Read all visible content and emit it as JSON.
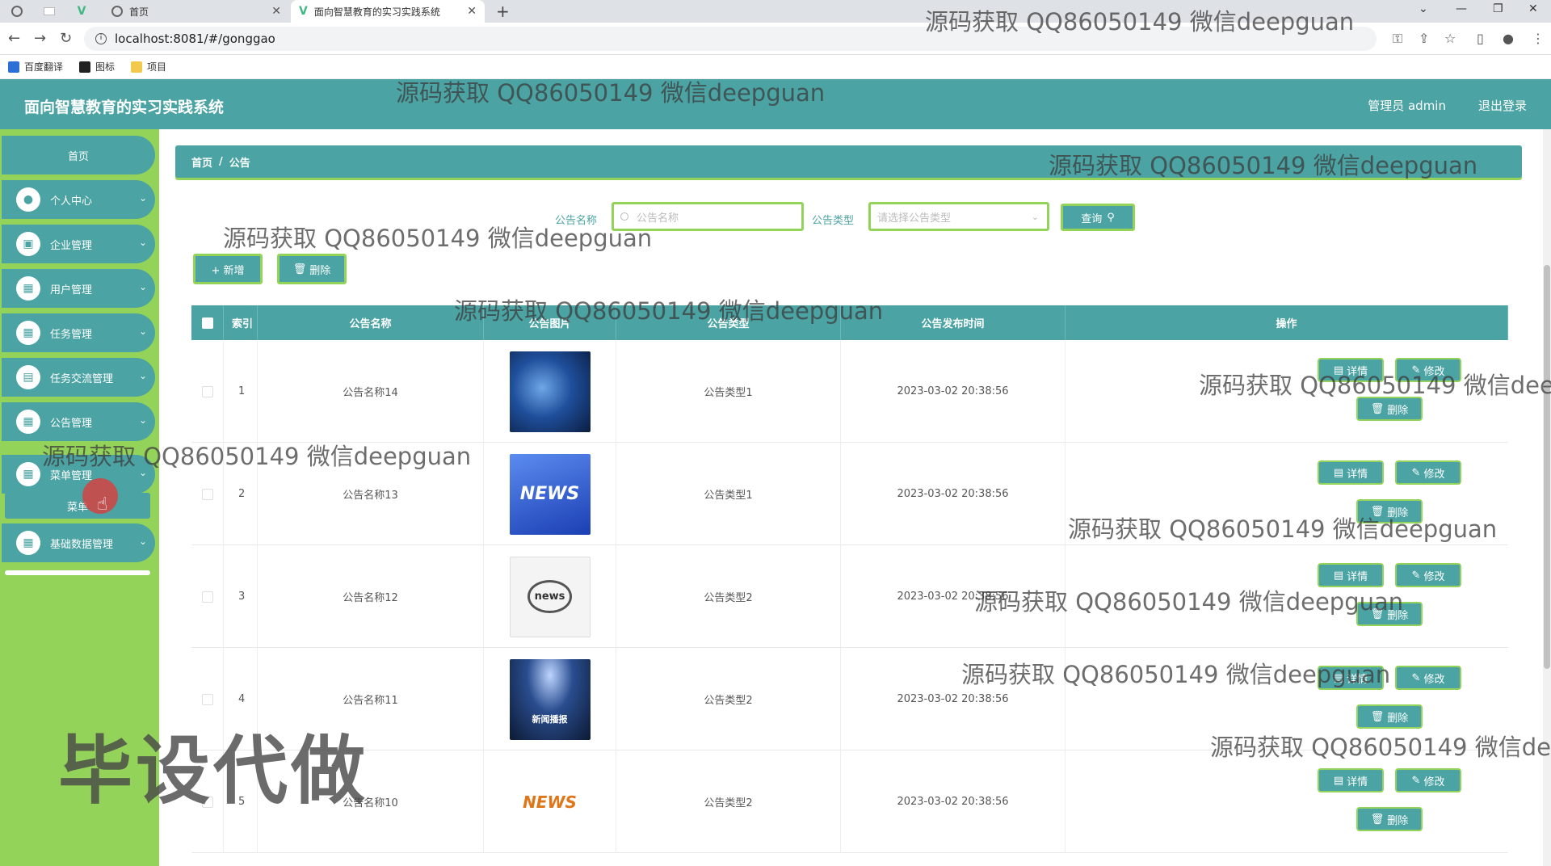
{
  "browser": {
    "tabs": [
      {
        "title": "首页"
      },
      {
        "title": "面向智慧教育的实习实践系统"
      }
    ],
    "url": "localhost:8081/#/gonggao",
    "bookmarks": [
      "百度翻译",
      "图标",
      "项目"
    ]
  },
  "header": {
    "title": "面向智慧教育的实习实践系统",
    "user": "管理员 admin",
    "logout": "退出登录"
  },
  "sidebar": {
    "items": [
      {
        "label": "首页"
      },
      {
        "label": "个人中心"
      },
      {
        "label": "企业管理"
      },
      {
        "label": "用户管理"
      },
      {
        "label": "任务管理"
      },
      {
        "label": "任务交流管理"
      },
      {
        "label": "公告管理"
      },
      {
        "label": "菜单管理"
      },
      {
        "label": "基础数据管理"
      }
    ],
    "sub_item": "菜单"
  },
  "breadcrumb": {
    "home": "首页",
    "sep": "/",
    "current": "公告"
  },
  "search": {
    "name_label": "公告名称",
    "name_placeholder": "公告名称",
    "type_label": "公告类型",
    "type_placeholder": "请选择公告类型",
    "query_button": "查询"
  },
  "actions": {
    "add": "+ 新增",
    "delete": "删除"
  },
  "table": {
    "columns": [
      "索引",
      "公告名称",
      "公告图片",
      "公告类型",
      "公告发布时间",
      "操作"
    ],
    "rows": [
      {
        "index": "1",
        "name": "公告名称14",
        "image_icon": "globe-image",
        "type": "公告类型1",
        "time": "2023-03-02 20:38:56"
      },
      {
        "index": "2",
        "name": "公告名称13",
        "image_icon": "news-image",
        "type": "公告类型1",
        "time": "2023-03-02 20:38:56"
      },
      {
        "index": "3",
        "name": "公告名称12",
        "image_icon": "newspaper-magnifier-image",
        "type": "公告类型2",
        "time": "2023-03-02 20:38:56"
      },
      {
        "index": "4",
        "name": "公告名称11",
        "image_icon": "stage-spotlight-image",
        "type": "公告类型2",
        "time": "2023-03-02 20:38:56"
      },
      {
        "index": "5",
        "name": "公告名称10",
        "image_icon": "news-figure-image",
        "type": "公告类型2",
        "time": "2023-03-02 20:38:56"
      }
    ],
    "row_buttons": {
      "detail": "详情",
      "edit": "修改",
      "delete": "删除"
    }
  },
  "watermarks": {
    "text": "源码获取 QQ86050149 微信deepguan",
    "big": "毕设代做"
  },
  "colors": {
    "teal": "#4ba3a3",
    "green": "#94d35a"
  },
  "thumbs": {
    "news": "NEWS",
    "news_small": "news",
    "stage": "新闻播报"
  }
}
